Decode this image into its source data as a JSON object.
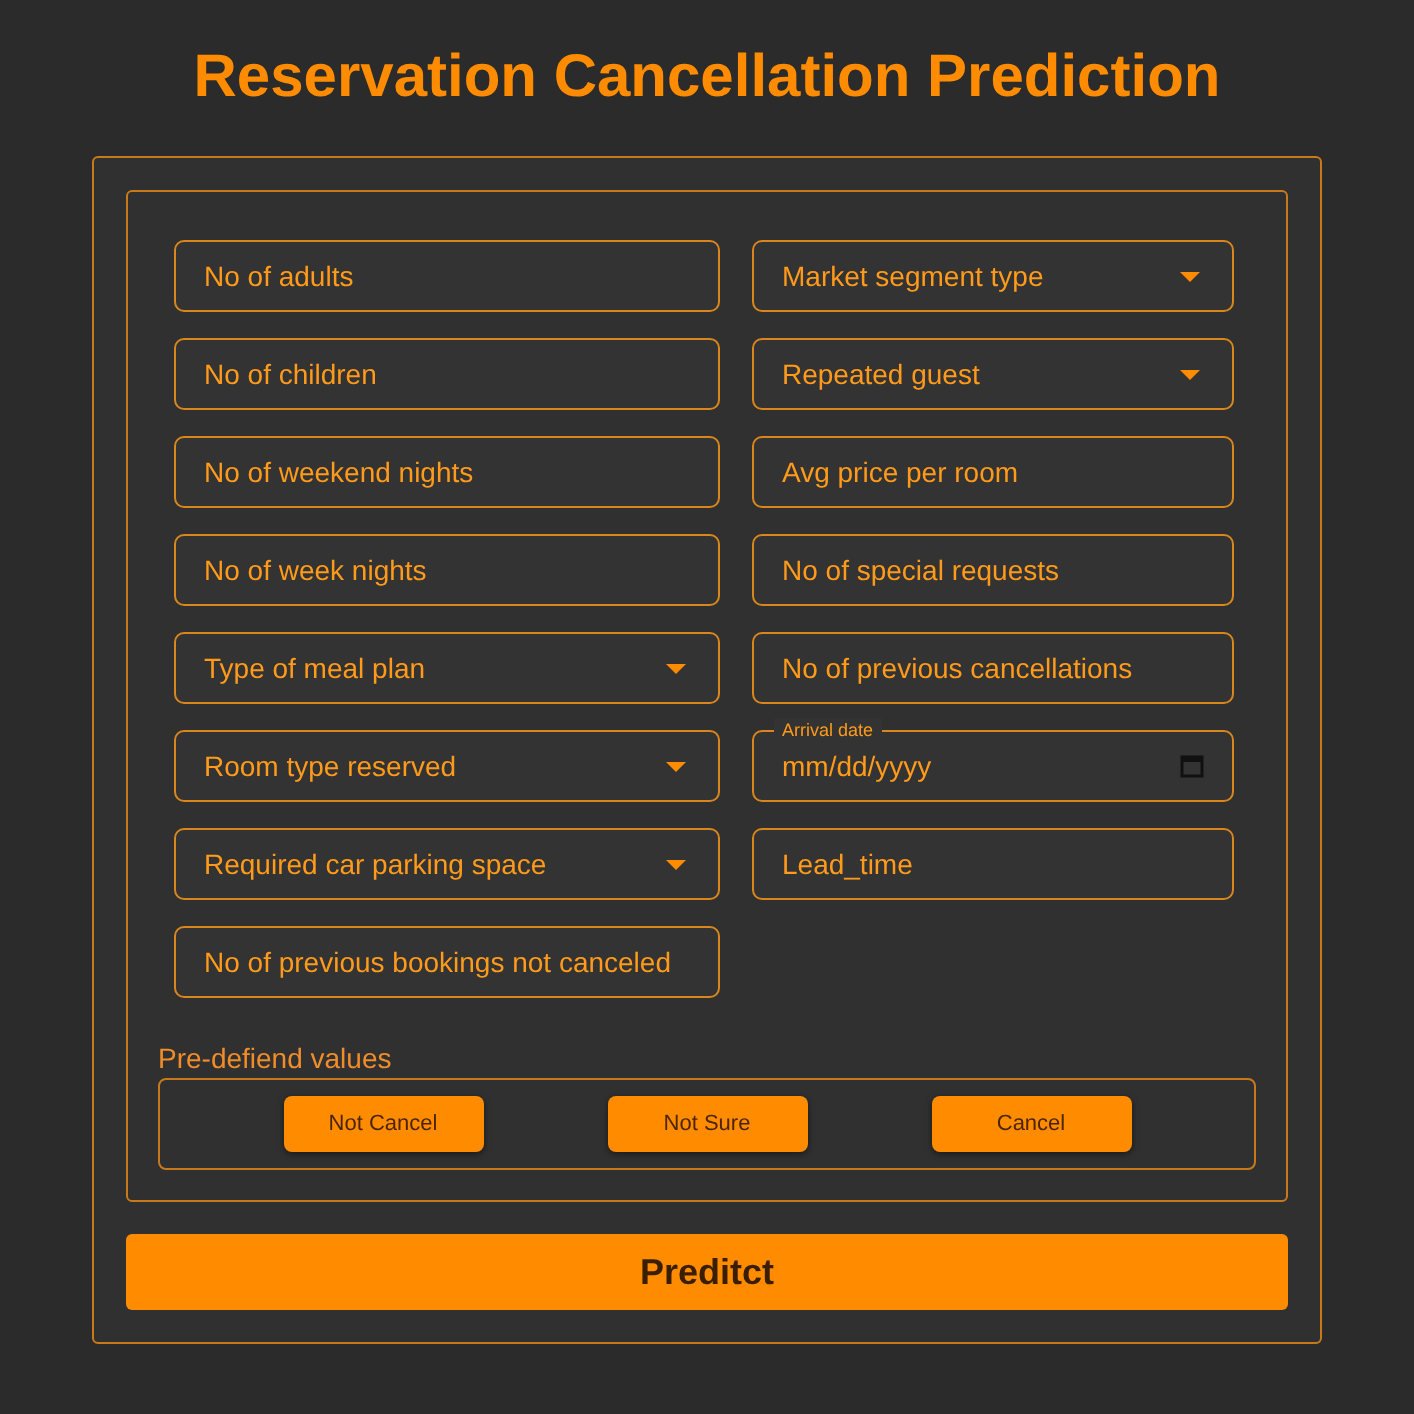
{
  "title": "Reservation Cancellation Prediction",
  "columns": [
    [
      {
        "kind": "text",
        "placeholder": "No of adults"
      },
      {
        "kind": "text",
        "placeholder": "No of children"
      },
      {
        "kind": "text",
        "placeholder": "No of weekend nights"
      },
      {
        "kind": "text",
        "placeholder": "No of week nights"
      },
      {
        "kind": "select",
        "placeholder": "Type of meal plan"
      },
      {
        "kind": "select",
        "placeholder": "Room type reserved"
      },
      {
        "kind": "select",
        "placeholder": "Required car parking space"
      },
      {
        "kind": "text",
        "placeholder": "No of previous bookings not canceled"
      }
    ],
    [
      {
        "kind": "select",
        "placeholder": "Market segment type"
      },
      {
        "kind": "select",
        "placeholder": "Repeated guest"
      },
      {
        "kind": "text",
        "placeholder": "Avg price per room"
      },
      {
        "kind": "text",
        "placeholder": "No of special requests"
      },
      {
        "kind": "text",
        "placeholder": "No of previous cancellations"
      },
      {
        "kind": "date",
        "label": "Arrival date",
        "placeholder": "mm/dd/yyyy"
      },
      {
        "kind": "text",
        "placeholder": "Lead_time"
      }
    ]
  ],
  "predefined": {
    "label": "Pre-defiend values",
    "buttons": [
      "Not Cancel",
      "Not Sure",
      "Cancel"
    ]
  },
  "submit": "Preditct"
}
